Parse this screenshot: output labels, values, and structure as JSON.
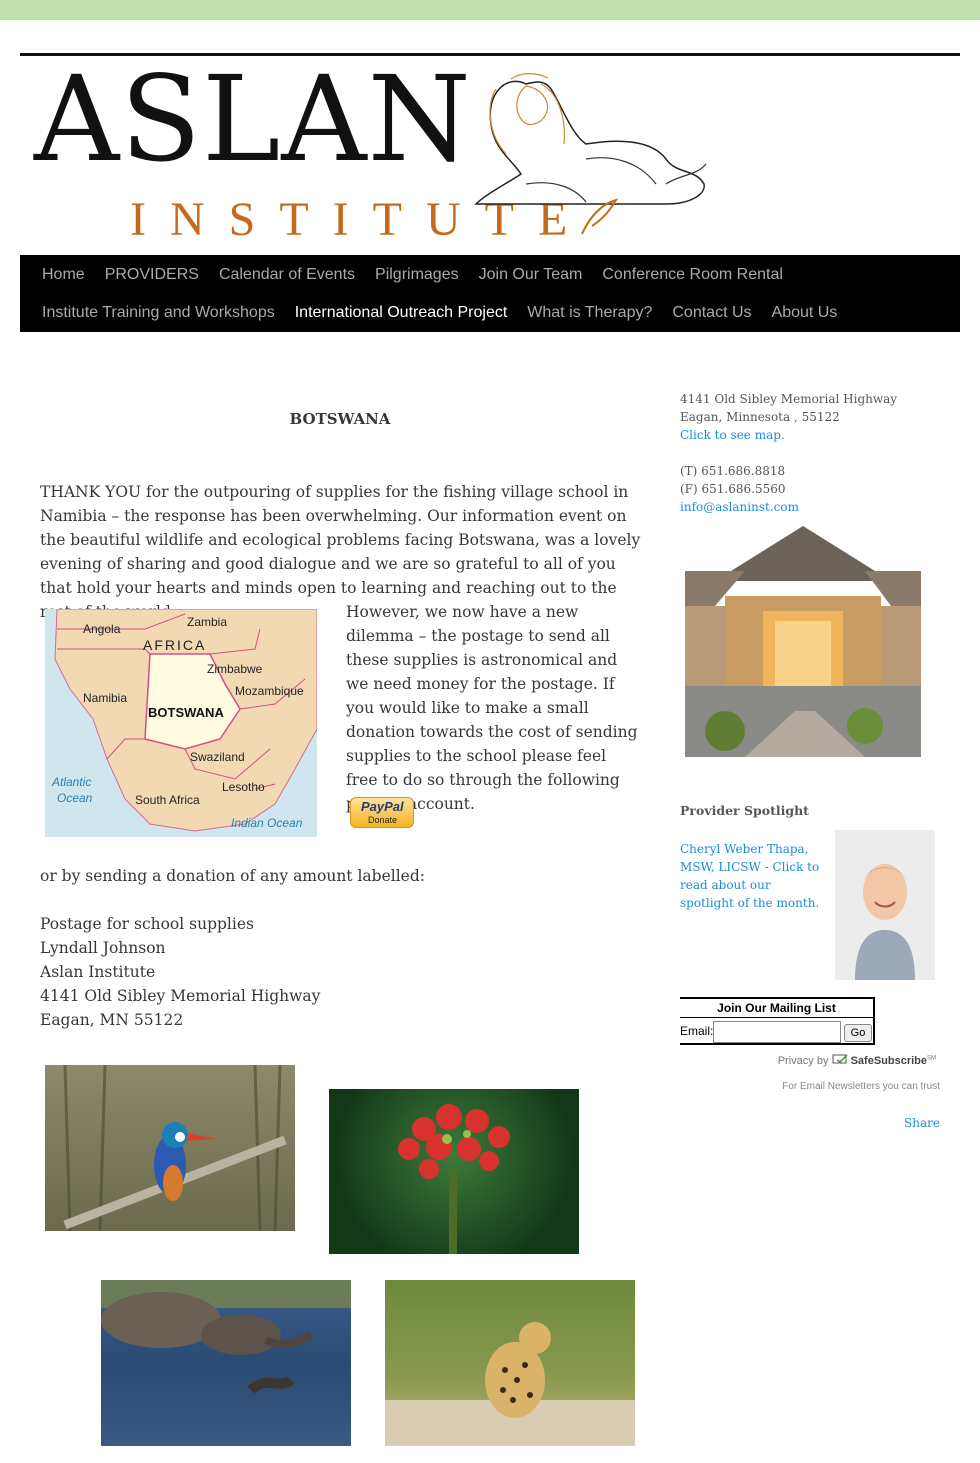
{
  "logo": {
    "line1": "ASLAN",
    "line2": "INSTITUTE"
  },
  "nav": {
    "row1": [
      "Home",
      "PROVIDERS",
      "Calendar of Events",
      "Pilgrimages",
      "Join Our Team",
      "Conference Room Rental"
    ],
    "row2": [
      "Institute Training and Workshops",
      "International Outreach Project",
      "What is Therapy?",
      "Contact Us",
      "About Us"
    ],
    "active": "International Outreach Project"
  },
  "main": {
    "title": "BOTSWANA",
    "paragraph1": "THANK YOU for the outpouring of supplies for the fishing village school in Namibia – the response has been overwhelming. Our information event on the beautiful wildlife and ecological problems facing Botswana, was a lovely evening of sharing and good dialogue and we are so grateful to all of you that hold your hearts and minds open to learning and reaching out to the rest of the world.",
    "paragraph2": "However, we now have a new dilemma – the postage to send all these supplies is astronomical and we need money for the postage. If you would like to make a small donation towards the cost of sending supplies to the school please feel free to do so through the following pay pal account.",
    "paragraph3": "or by sending a donation of any amount labelled:",
    "address_lines": [
      "Postage for school supplies",
      "Lyndall Johnson",
      "Aslan Institute",
      "4141 Old Sibley Memorial Highway",
      "Eagan, MN 55122"
    ],
    "paypal": {
      "brand": "PayPal",
      "label": "Donate"
    },
    "map_labels": {
      "angola": "Angola",
      "zambia": "Zambia",
      "africa": "AFRICA",
      "zimbabwe": "Zimbabwe",
      "namibia": "Namibia",
      "mozambique": "Mozambique",
      "botswana": "BOTSWANA",
      "swaziland": "Swaziland",
      "lesotho": "Lesotho",
      "atlantic": "Atlantic",
      "ocean1": "Ocean",
      "south_africa": "South Africa",
      "indian_ocean": "Indian Ocean"
    }
  },
  "sidebar": {
    "address1": "4141 Old Sibley Memorial Highway",
    "address2": "Eagan, Minnesota , 55122",
    "map_link": "Click to see map.",
    "phone": "(T) 651.686.8818",
    "fax": "(F) 651.686.5560",
    "email": "info@aslaninst.com",
    "spotlight_title": "Provider Spotlight",
    "spotlight_text": "Cheryl Weber Thapa, MSW, LICSW - Click to read about our spotlight of the month.",
    "mailing": {
      "title": "Join Our Mailing List",
      "email_label": "Email:",
      "go": "Go"
    },
    "safesub": {
      "privacy": "Privacy",
      "by": "by",
      "brand": "SafeSubscribe",
      "sm": "SM",
      "tagline": "For Email Newsletters you can trust"
    },
    "share": "Share"
  },
  "colors": {
    "topbar": "#bfe0ac",
    "nav_bg": "#000000",
    "link": "#1b8be0",
    "logo_orange": "#c56a1c"
  }
}
